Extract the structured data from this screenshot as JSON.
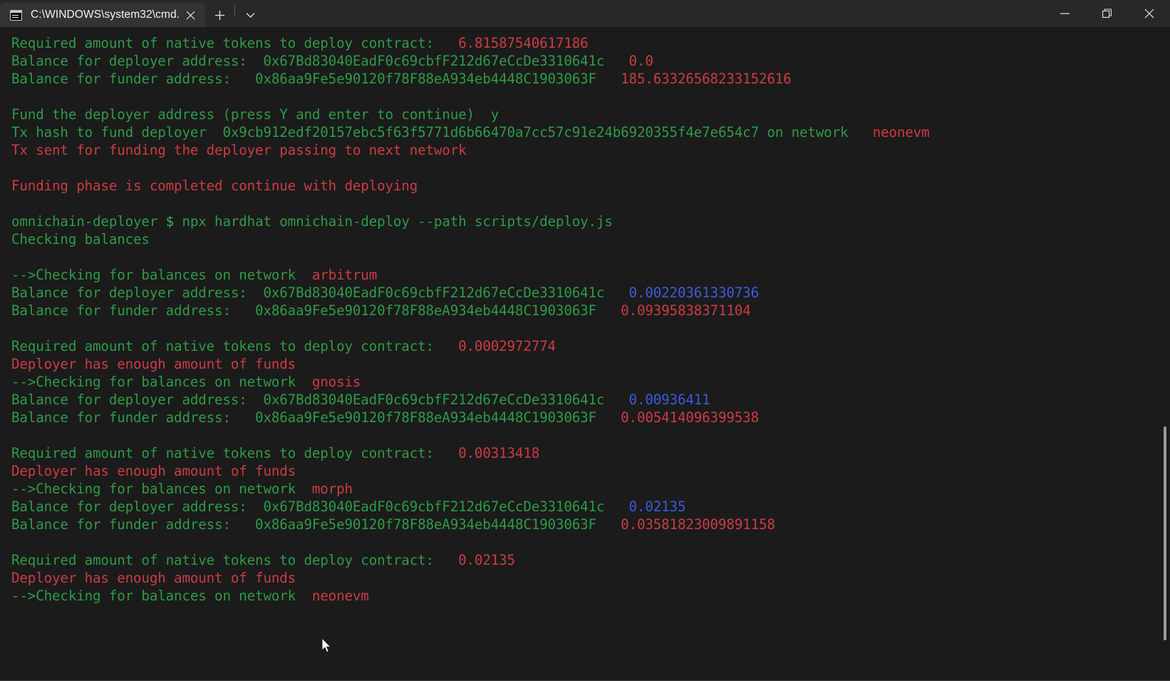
{
  "window": {
    "tab": {
      "title": "C:\\WINDOWS\\system32\\cmd.",
      "icon": "console-icon",
      "close_icon": "close-icon"
    },
    "new_tab_icon": "plus-icon",
    "dropdown_icon": "chevron-down-icon",
    "controls": {
      "minimize": "minimize-icon",
      "maximize": "restore-icon",
      "close": "close-icon"
    }
  },
  "colors": {
    "green": "#2e9b47",
    "red": "#cc3b44",
    "blue": "#3b5bdb",
    "background": "#1b1b1b",
    "titlebar": "#282828",
    "tab_active": "#333333"
  },
  "addresses": {
    "deployer": "0x67Bd83040EadF0c69cbfF212d67eCcDe3310641c",
    "funder": "0x86aa9Fe5e90120f78F88eA934eb4448C1903063F"
  },
  "terminal": {
    "lines": [
      {
        "id": "l01",
        "segs": [
          {
            "t": "Required amount of native tokens to deploy contract:   ",
            "c": "g"
          },
          {
            "t": "6.81587540617186",
            "c": "r"
          }
        ]
      },
      {
        "id": "l02",
        "segs": [
          {
            "t": "Balance for deployer address:  0x67Bd83040EadF0c69cbfF212d67eCcDe3310641c   ",
            "c": "g"
          },
          {
            "t": "0.0",
            "c": "r"
          }
        ]
      },
      {
        "id": "l03",
        "segs": [
          {
            "t": "Balance for funder address:   0x86aa9Fe5e90120f78F88eA934eb4448C1903063F   ",
            "c": "g"
          },
          {
            "t": "185.63326568233152616",
            "c": "r"
          }
        ]
      },
      {
        "id": "l04",
        "blank": true
      },
      {
        "id": "l05",
        "segs": [
          {
            "t": "Fund the deployer address (press Y and enter to continue)  y",
            "c": "g"
          }
        ]
      },
      {
        "id": "l06",
        "segs": [
          {
            "t": "Tx hash to fund deployer  0x9cb912edf20157ebc5f63f5771d6b66470a7cc57c91e24b6920355f4e7e654c7 on network   ",
            "c": "g"
          },
          {
            "t": "neonevm",
            "c": "r"
          }
        ]
      },
      {
        "id": "l07",
        "segs": [
          {
            "t": "Tx sent for funding the deployer passing to next network",
            "c": "r"
          }
        ]
      },
      {
        "id": "l08",
        "blank": true
      },
      {
        "id": "l09",
        "segs": [
          {
            "t": "Funding phase is completed continue with deploying",
            "c": "r"
          }
        ]
      },
      {
        "id": "l10",
        "blank": true
      },
      {
        "id": "l11",
        "segs": [
          {
            "t": "omnichain-deployer ",
            "c": "g"
          },
          {
            "t": "$",
            "c": "gb"
          },
          {
            "t": " npx hardhat omnichain-deploy --path scripts/deploy.js",
            "c": "g"
          }
        ]
      },
      {
        "id": "l12",
        "segs": [
          {
            "t": "Checking balances",
            "c": "g"
          }
        ]
      },
      {
        "id": "l13",
        "blank": true
      },
      {
        "id": "l14",
        "segs": [
          {
            "t": "-->Checking for balances on network  ",
            "c": "g"
          },
          {
            "t": "arbitrum",
            "c": "r"
          }
        ]
      },
      {
        "id": "l15",
        "segs": [
          {
            "t": "Balance for deployer address:  0x67Bd83040EadF0c69cbfF212d67eCcDe3310641c   ",
            "c": "g"
          },
          {
            "t": "0.00220361330736",
            "c": "b"
          }
        ]
      },
      {
        "id": "l16",
        "segs": [
          {
            "t": "Balance for funder address:   0x86aa9Fe5e90120f78F88eA934eb4448C1903063F   ",
            "c": "g"
          },
          {
            "t": "0.09395838371104",
            "c": "r"
          }
        ]
      },
      {
        "id": "l17",
        "blank": true
      },
      {
        "id": "l18",
        "segs": [
          {
            "t": "Required amount of native tokens to deploy contract:   ",
            "c": "g"
          },
          {
            "t": "0.0002972774",
            "c": "r"
          }
        ]
      },
      {
        "id": "l19",
        "segs": [
          {
            "t": "Deployer has enough amount of funds",
            "c": "r"
          }
        ]
      },
      {
        "id": "l20",
        "segs": [
          {
            "t": "-->Checking for balances on network  ",
            "c": "g"
          },
          {
            "t": "gnosis",
            "c": "r"
          }
        ]
      },
      {
        "id": "l21",
        "segs": [
          {
            "t": "Balance for deployer address:  0x67Bd83040EadF0c69cbfF212d67eCcDe3310641c   ",
            "c": "g"
          },
          {
            "t": "0.00936411",
            "c": "b"
          }
        ]
      },
      {
        "id": "l22",
        "segs": [
          {
            "t": "Balance for funder address:   0x86aa9Fe5e90120f78F88eA934eb4448C1903063F   ",
            "c": "g"
          },
          {
            "t": "0.005414096399538",
            "c": "r"
          }
        ]
      },
      {
        "id": "l23",
        "blank": true
      },
      {
        "id": "l24",
        "segs": [
          {
            "t": "Required amount of native tokens to deploy contract:   ",
            "c": "g"
          },
          {
            "t": "0.00313418",
            "c": "r"
          }
        ]
      },
      {
        "id": "l25",
        "segs": [
          {
            "t": "Deployer has enough amount of funds",
            "c": "r"
          }
        ]
      },
      {
        "id": "l26",
        "segs": [
          {
            "t": "-->Checking for balances on network  ",
            "c": "g"
          },
          {
            "t": "morph",
            "c": "r"
          }
        ]
      },
      {
        "id": "l27",
        "segs": [
          {
            "t": "Balance for deployer address:  0x67Bd83040EadF0c69cbfF212d67eCcDe3310641c   ",
            "c": "g"
          },
          {
            "t": "0.02135",
            "c": "b"
          }
        ]
      },
      {
        "id": "l28",
        "segs": [
          {
            "t": "Balance for funder address:   0x86aa9Fe5e90120f78F88eA934eb4448C1903063F   ",
            "c": "g"
          },
          {
            "t": "0.03581823009891158",
            "c": "r"
          }
        ]
      },
      {
        "id": "l29",
        "blank": true
      },
      {
        "id": "l30",
        "segs": [
          {
            "t": "Required amount of native tokens to deploy contract:   ",
            "c": "g"
          },
          {
            "t": "0.02135",
            "c": "r"
          }
        ]
      },
      {
        "id": "l31",
        "segs": [
          {
            "t": "Deployer has enough amount of funds",
            "c": "r"
          }
        ]
      },
      {
        "id": "l32",
        "segs": [
          {
            "t": "-->Checking for balances on network  ",
            "c": "g"
          },
          {
            "t": "neonevm",
            "c": "r"
          }
        ]
      }
    ]
  }
}
